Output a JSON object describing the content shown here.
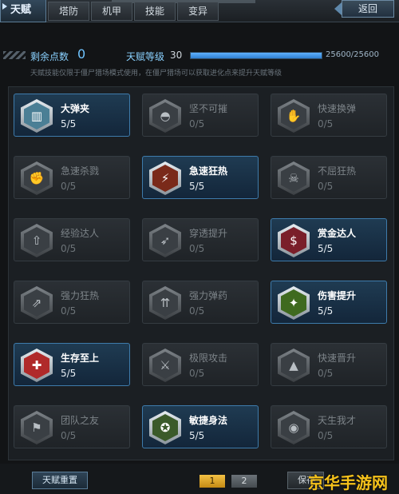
{
  "nav": {
    "active_tab": "天赋",
    "tabs": [
      "塔防",
      "机甲",
      "技能",
      "变异"
    ],
    "back_label": "返回"
  },
  "header": {
    "points_label": "剩余点数",
    "points_value": "0",
    "level_label": "天赋等级",
    "level_value": "30",
    "xp_text": "25600/25600",
    "xp_progress": 1.0,
    "hint": "天赋技能仅限于僵尸猎场模式使用，在僵尸猎场可以获取进化点来提升天赋等级"
  },
  "talents": [
    {
      "name": "大弹夹",
      "level": "5/5",
      "active": true,
      "icon": "magazine-icon"
    },
    {
      "name": "坚不可摧",
      "level": "0/5",
      "active": false,
      "icon": "helmet-icon"
    },
    {
      "name": "快速换弹",
      "level": "0/5",
      "active": false,
      "icon": "hand-icon"
    },
    {
      "name": "急速杀戮",
      "level": "0/5",
      "active": false,
      "icon": "fist-icon"
    },
    {
      "name": "急速狂热",
      "level": "5/5",
      "active": true,
      "icon": "rage-icon"
    },
    {
      "name": "不屈狂热",
      "level": "0/5",
      "active": false,
      "icon": "skull-icon"
    },
    {
      "name": "经验达人",
      "level": "0/5",
      "active": false,
      "icon": "exp-up-icon"
    },
    {
      "name": "穿透提升",
      "level": "0/5",
      "active": false,
      "icon": "pierce-icon"
    },
    {
      "name": "赏金达人",
      "level": "5/5",
      "active": true,
      "icon": "dollar-icon"
    },
    {
      "name": "强力狂热",
      "level": "0/5",
      "active": false,
      "icon": "power-rage-icon"
    },
    {
      "name": "强力弹药",
      "level": "0/5",
      "active": false,
      "icon": "ammo-icon"
    },
    {
      "name": "伤害提升",
      "level": "5/5",
      "active": true,
      "icon": "damage-icon"
    },
    {
      "name": "生存至上",
      "level": "5/5",
      "active": true,
      "icon": "medkit-icon"
    },
    {
      "name": "极限攻击",
      "level": "0/5",
      "active": false,
      "icon": "blade-icon"
    },
    {
      "name": "快速晋升",
      "level": "0/5",
      "active": false,
      "icon": "rank-up-icon"
    },
    {
      "name": "团队之友",
      "level": "0/5",
      "active": false,
      "icon": "team-icon"
    },
    {
      "name": "敏捷身法",
      "level": "5/5",
      "active": true,
      "icon": "agility-icon"
    },
    {
      "name": "天生我才",
      "level": "0/5",
      "active": false,
      "icon": "eye-icon"
    }
  ],
  "footer": {
    "reset_label": "天赋重置",
    "pages": [
      "1",
      "2"
    ],
    "current_page": "1",
    "save_label": "保存"
  },
  "watermark": "京华手游网",
  "colors": {
    "accent": "#3e7bab",
    "points": "#6fc4ff",
    "page_active": "#f3c144",
    "watermark": "#f5c21b"
  }
}
